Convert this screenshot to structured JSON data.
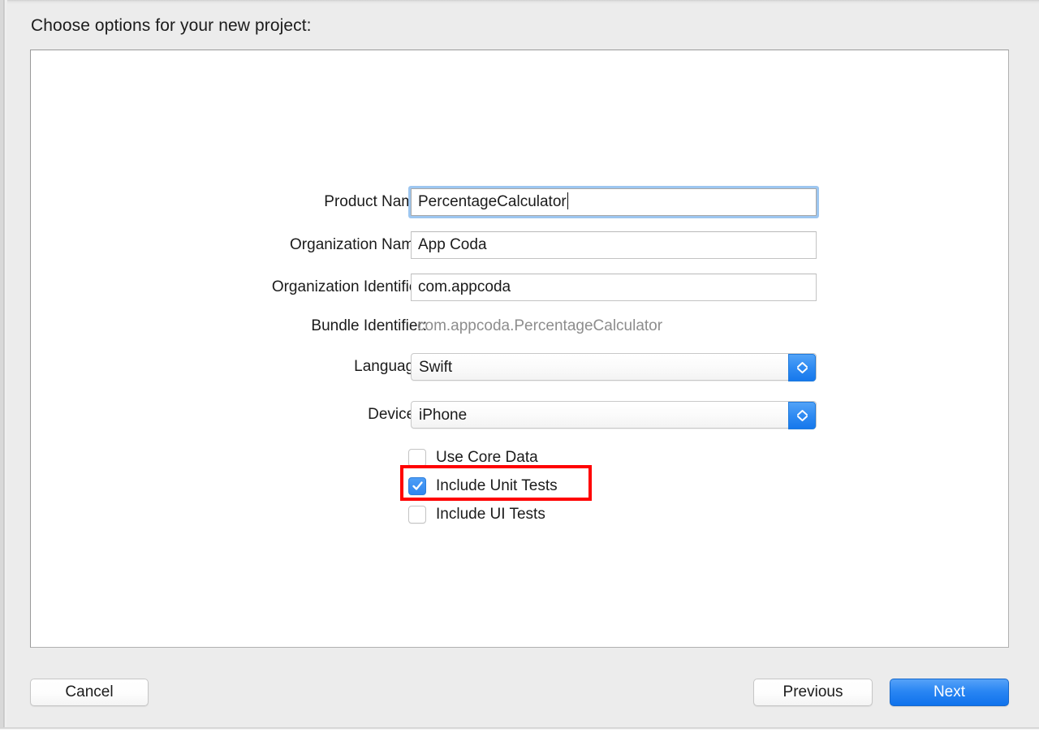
{
  "window": {
    "prompt_title": "Choose options for your new project:"
  },
  "form": {
    "rows": [
      {
        "label": "Product Name:",
        "value": "PercentageCalculator",
        "type": "text",
        "focused": true
      },
      {
        "label": "Organization Name:",
        "value": "App Coda",
        "type": "text",
        "focused": false
      },
      {
        "label": "Organization Identifier:",
        "value": "com.appcoda",
        "type": "text",
        "focused": false
      },
      {
        "label": "Bundle Identifier:",
        "value": "com.appcoda.PercentageCalculator",
        "type": "static",
        "focused": false
      },
      {
        "label": "Language:",
        "value": "Swift",
        "type": "popup",
        "focused": false
      },
      {
        "label": "Devices:",
        "value": "iPhone",
        "type": "popup",
        "focused": false
      }
    ]
  },
  "checkboxes": [
    {
      "label": "Use Core Data",
      "checked": false,
      "highlighted": false
    },
    {
      "label": "Include Unit Tests",
      "checked": true,
      "highlighted": true
    },
    {
      "label": "Include UI Tests",
      "checked": false,
      "highlighted": false
    }
  ],
  "footer": {
    "cancel_label": "Cancel",
    "previous_label": "Previous",
    "next_label": "Next"
  },
  "colors": {
    "accent_blue": "#2a86f3",
    "focus_ring": "#9dc6f0",
    "annotation_red": "#ff0000",
    "window_background": "#ececec",
    "panel_background": "#ffffff",
    "muted_text": "#8d8d8d"
  }
}
